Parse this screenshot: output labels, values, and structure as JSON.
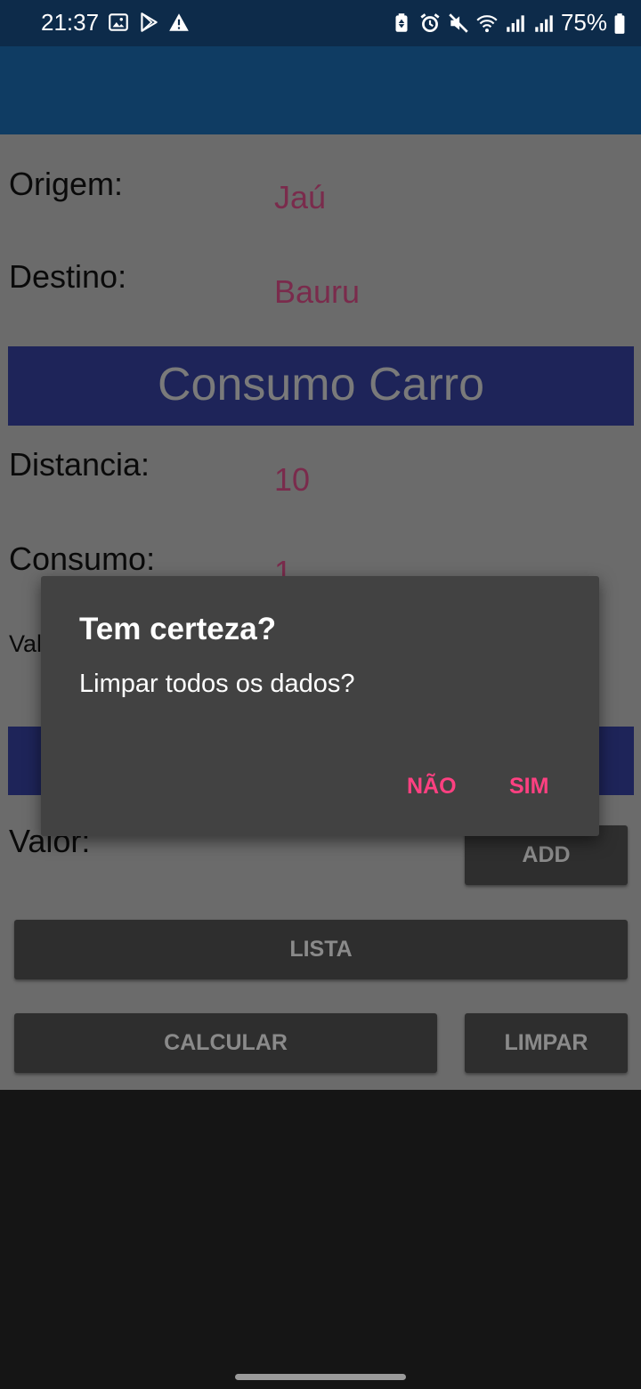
{
  "status_bar": {
    "time": "21:37",
    "battery": "75%",
    "left_icons": [
      "image-icon",
      "play-store-icon",
      "warning-icon"
    ],
    "right_icons": [
      "battery-saver-icon",
      "alarm-icon",
      "mute-icon",
      "wifi-icon",
      "signal-icon",
      "signal-icon",
      "battery-icon"
    ]
  },
  "form": {
    "origem_label": "Origem:",
    "origem_value": "Jaú",
    "destino_label": "Destino:",
    "destino_value": "Bauru",
    "section_title": "Consumo Carro",
    "distancia_label": "Distancia:",
    "distancia_value": "10",
    "consumo_label": "Consumo:",
    "consumo_value": "1",
    "valor_partial_label": "Val",
    "valor_label": "Valor:",
    "add_button": "ADD",
    "lista_button": "LISTA",
    "calcular_button": "CALCULAR",
    "limpar_button": "LIMPAR"
  },
  "dialog": {
    "title": "Tem certeza?",
    "message": "Limpar todos os dados?",
    "negative_button": "NÃO",
    "positive_button": "SIM"
  },
  "colors": {
    "status_bar": "#0d2b4a",
    "app_bar": "#0f3c63",
    "accent": "#ff4081",
    "banner": "#1e2459"
  }
}
